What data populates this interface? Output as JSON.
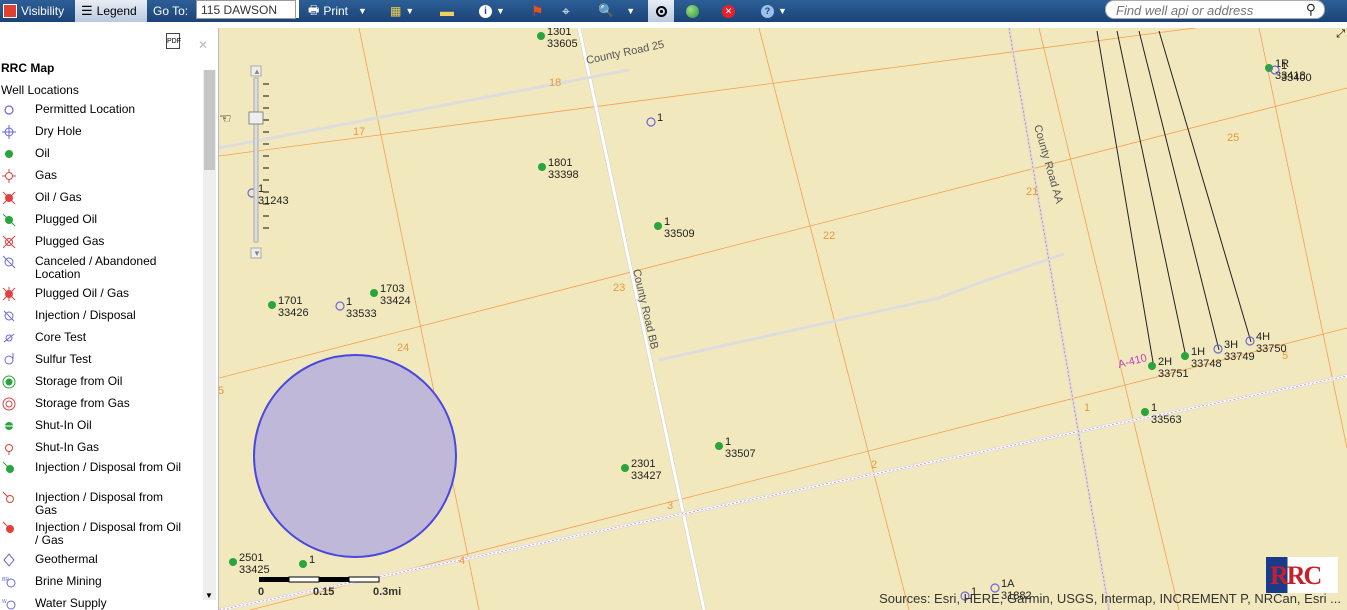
{
  "toolbar": {
    "visibility": "Visibility",
    "legend": "Legend",
    "goto_label": "Go To:",
    "goto_value": "115 DAWSON",
    "print": "Print",
    "search_placeholder": "Find well api or address"
  },
  "legend": {
    "title": "RRC Map",
    "subtitle": "Well Locations",
    "items": [
      {
        "label": "Permitted Location",
        "icon": "open-circle-icon"
      },
      {
        "label": "Dry Hole",
        "icon": "dry-hole-icon"
      },
      {
        "label": "Oil",
        "icon": "oil-icon"
      },
      {
        "label": "Gas",
        "icon": "gas-icon"
      },
      {
        "label": "Oil / Gas",
        "icon": "oil-gas-icon"
      },
      {
        "label": "Plugged Oil",
        "icon": "plugged-oil-icon"
      },
      {
        "label": "Plugged Gas",
        "icon": "plugged-gas-icon"
      },
      {
        "label": "Canceled / Abandoned Location",
        "icon": "canceled-icon"
      },
      {
        "label": "Plugged Oil / Gas",
        "icon": "plugged-oil-gas-icon"
      },
      {
        "label": "Injection / Disposal",
        "icon": "injection-icon"
      },
      {
        "label": "Core Test",
        "icon": "core-test-icon"
      },
      {
        "label": "Sulfur Test",
        "icon": "sulfur-test-icon"
      },
      {
        "label": "Storage from Oil",
        "icon": "storage-oil-icon"
      },
      {
        "label": "Storage from Gas",
        "icon": "storage-gas-icon"
      },
      {
        "label": "Shut-In Oil",
        "icon": "shut-in-oil-icon"
      },
      {
        "label": "Shut-In Gas",
        "icon": "shut-in-gas-icon"
      },
      {
        "label": "Injection / Disposal from Oil",
        "icon": "injection-oil-icon"
      },
      {
        "label": "Injection / Disposal from Gas",
        "icon": "injection-gas-icon"
      },
      {
        "label": "Injection / Disposal from Oil / Gas",
        "icon": "injection-oil-gas-icon"
      },
      {
        "label": "Geothermal",
        "icon": "geothermal-icon"
      },
      {
        "label": "Brine Mining",
        "icon": "brine-mining-icon"
      },
      {
        "label": "Water Supply",
        "icon": "water-supply-icon"
      }
    ]
  },
  "map": {
    "roads": [
      "County Road 25",
      "County Road BB",
      "County Road AA"
    ],
    "survey_label": "A-410",
    "tract_numbers": [
      "18",
      "17",
      "25",
      "21",
      "22",
      "23",
      "24",
      "5",
      "1",
      "2",
      "3",
      "4",
      "5"
    ],
    "wells": [
      {
        "name": "1301",
        "api": "33605"
      },
      {
        "name": "1",
        "api": ""
      },
      {
        "name": "1801",
        "api": "33398"
      },
      {
        "name": "1",
        "api": "33509"
      },
      {
        "name": "1",
        "api": "31243"
      },
      {
        "name": "1701",
        "api": "33426"
      },
      {
        "name": "1",
        "api": "33533"
      },
      {
        "name": "1703",
        "api": "33424"
      },
      {
        "name": "2301",
        "api": "33427"
      },
      {
        "name": "1",
        "api": "33507"
      },
      {
        "name": "2501",
        "api": "33425"
      },
      {
        "name": "1",
        "api": ""
      },
      {
        "name": "1R",
        "api": "33418"
      },
      {
        "name": "1",
        "api": "33400"
      },
      {
        "name": "2H",
        "api": "33751"
      },
      {
        "name": "1H",
        "api": "33748"
      },
      {
        "name": "3H",
        "api": "33749"
      },
      {
        "name": "4H",
        "api": "33750"
      },
      {
        "name": "1",
        "api": "33563"
      },
      {
        "name": "1A",
        "api": "31882"
      },
      {
        "name": "1",
        "api": ""
      }
    ],
    "scale": {
      "ticks": [
        "0",
        "0.15",
        "0.3mi"
      ]
    },
    "attribution": "Sources: Esri, HERE, Garmin, USGS, Intermap, INCREMENT P, NRCan, Esri ...",
    "logo_text": "RRC"
  },
  "colors": {
    "oil": "#2aa43c",
    "permitted": "#6a6ad8",
    "tract_line": "#f39a4a",
    "buffer": "#c0b8d8"
  }
}
